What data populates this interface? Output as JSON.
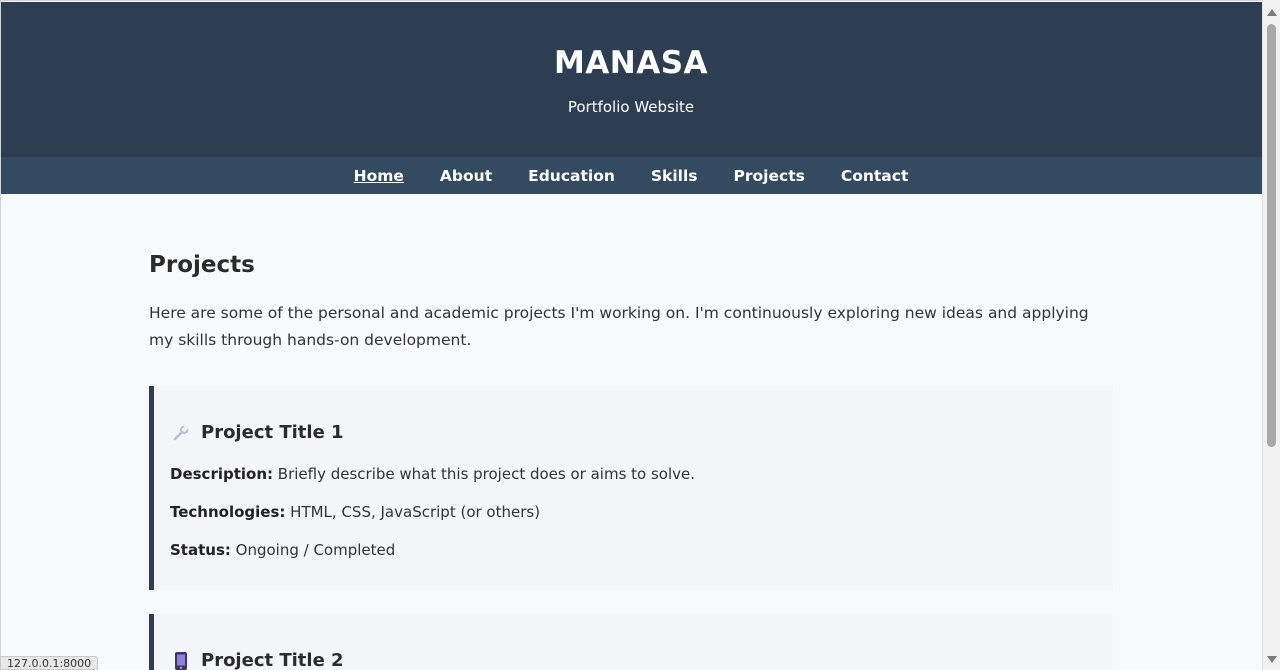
{
  "header": {
    "title": "MANASA",
    "subtitle": "Portfolio Website"
  },
  "nav": {
    "items": [
      {
        "label": "Home",
        "active": true
      },
      {
        "label": "About",
        "active": false
      },
      {
        "label": "Education",
        "active": false
      },
      {
        "label": "Skills",
        "active": false
      },
      {
        "label": "Projects",
        "active": false
      },
      {
        "label": "Contact",
        "active": false
      }
    ]
  },
  "projects_section": {
    "title": "Projects",
    "intro": "Here are some of the personal and academic projects I'm working on. I'm continuously exploring new ideas and applying my skills through hands-on development.",
    "projects": [
      {
        "icon": "wrench-icon",
        "title": "Project Title 1",
        "description_label": "Description:",
        "description": " Briefly describe what this project does or aims to solve.",
        "technologies_label": "Technologies:",
        "technologies": " HTML, CSS, JavaScript (or others)",
        "status_label": "Status:",
        "status": " Ongoing / Completed"
      },
      {
        "icon": "mobile-phone-icon",
        "title": "Project Title 2"
      }
    ]
  },
  "browser": {
    "status_url": "127.0.0.1:8000"
  },
  "colors": {
    "header_bg": "#2e3e52",
    "nav_bg": "#344a60",
    "page_bg": "#f7f9fb",
    "card_bg": "#f3f5f8",
    "card_accent": "#2e3e52"
  }
}
